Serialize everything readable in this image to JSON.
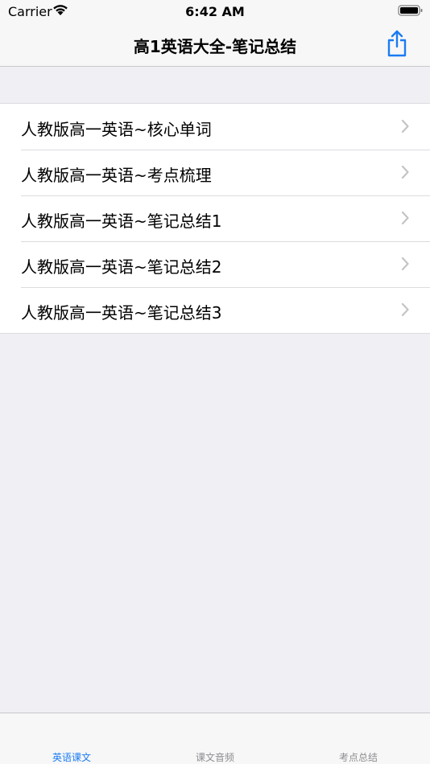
{
  "status_bar": {
    "carrier": "Carrier",
    "time": "6:42 AM"
  },
  "nav": {
    "title": "高1英语大全-笔记总结",
    "share_icon": "share-icon"
  },
  "list": {
    "items": [
      {
        "label": "人教版高一英语~核心单词"
      },
      {
        "label": "人教版高一英语~考点梳理"
      },
      {
        "label": "人教版高一英语~笔记总结1"
      },
      {
        "label": "人教版高一英语~笔记总结2"
      },
      {
        "label": "人教版高一英语~笔记总结3"
      }
    ]
  },
  "tabs": [
    {
      "label": "英语课文",
      "active": true
    },
    {
      "label": "课文音频",
      "active": false
    },
    {
      "label": "考点总结",
      "active": false
    }
  ],
  "colors": {
    "accent": "#1a7cf3",
    "background": "#efeff4",
    "bar": "#f7f7f7",
    "chevron": "#c4c4c7"
  }
}
